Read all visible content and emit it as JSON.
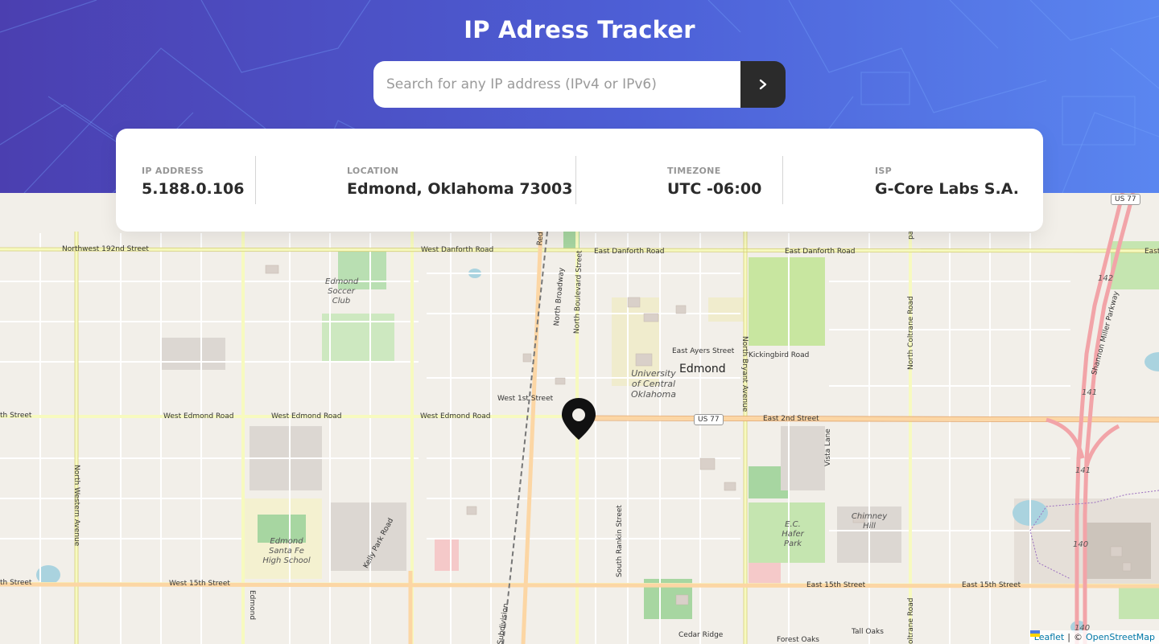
{
  "app": {
    "title": "IP Adress Tracker"
  },
  "search": {
    "placeholder": "Search for any IP address (IPv4 or IPv6)",
    "value": "",
    "button_icon": "chevron-right-icon"
  },
  "stats": [
    {
      "label": "IP ADDRESS",
      "value": "5.188.0.106"
    },
    {
      "label": "LOCATION",
      "value": "Edmond, Oklahoma 73003"
    },
    {
      "label": "TIMEZONE",
      "value": "UTC -06:00"
    },
    {
      "label": "ISP",
      "value": "G-Core Labs S.A."
    }
  ],
  "map": {
    "city_label": "Edmond",
    "marker_icon": "location-pin-icon",
    "roads": {
      "nw192": "Northwest 192nd Street",
      "west_danforth": "West Danforth Road",
      "east_danforth": "East Danforth Road",
      "east_danforth2": "East Danforth Road",
      "west_edmond1": "West Edmond Road",
      "west_edmond2": "West Edmond Road",
      "west_edmond3": "West Edmond Road",
      "east_2nd": "East 2nd Street",
      "west_1st": "West 1st Street",
      "east_ayers": "East Ayers Street",
      "kickingbird": "Kickingbird Road",
      "west_15th": "West 15th Street",
      "east_15th1": "East 15th Street",
      "east_15th2": "East 15th Street",
      "n_broadway": "North Broadway",
      "n_boulevard": "North Boulevard Street",
      "n_bryant": "North Bryant Avenue",
      "n_coltrane": "North Coltrane Road",
      "shannon": "Shannon Miller Parkway",
      "n_western": "North Western Avenue",
      "s_rankin": "South Rankin Street",
      "vista": "Vista Lane",
      "kelly_park": "Kelly Park Road",
      "cedar_ridge": "Cedar Ridge",
      "forest_oaks": "Forest Oaks",
      "tall_oaks": "Tall Oaks",
      "subdivision": "Subdivision",
      "edmond_road_v": "Edmond",
      "red": "Red",
      "pa": "pa",
      "th_street1": "th Street",
      "th_street2": "th Street",
      "east_edge": "East",
      "oltrane": "oltrane Road"
    },
    "places": {
      "soccer": "Edmond Soccer Club",
      "uco": "University of Central Oklahoma",
      "santa_fe": "Edmond Santa Fe High School",
      "hafer": "E.C. Hafer Park",
      "chimney": "Chimney Hill"
    },
    "shields": [
      "US 77",
      "US 77"
    ],
    "route_numbers": [
      "142",
      "141",
      "141",
      "140",
      "140"
    ],
    "attribution": {
      "leaflet": "Leaflet",
      "separator": "|",
      "copyright": "©",
      "osm": "OpenStreetMap"
    }
  }
}
